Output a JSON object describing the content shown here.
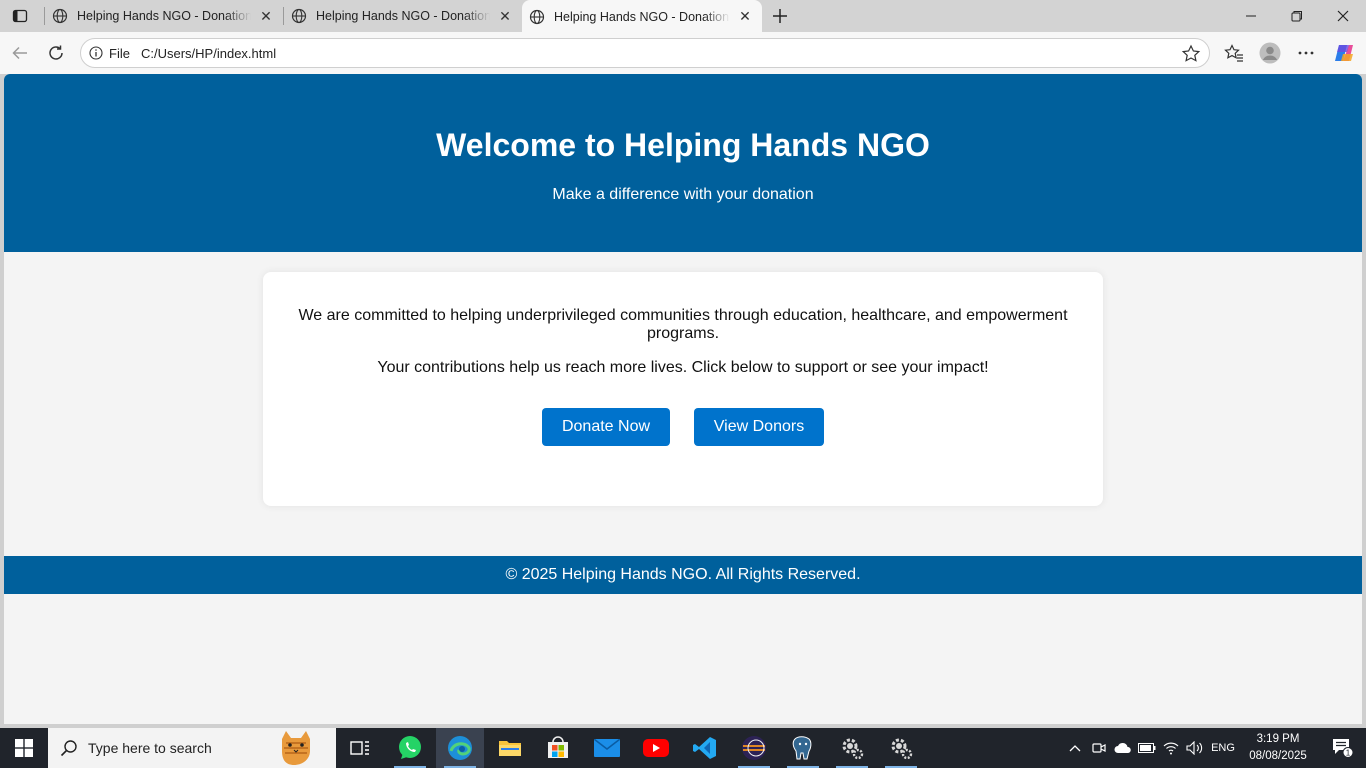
{
  "browser": {
    "tabs": [
      {
        "title": "Helping Hands NGO - Donation P",
        "active": false
      },
      {
        "title": "Helping Hands NGO - Donation P",
        "active": false
      },
      {
        "title": "Helping Hands NGO - Donation P",
        "active": true
      }
    ],
    "address": {
      "scheme_label": "File",
      "url": "C:/Users/HP/index.html"
    }
  },
  "page": {
    "header": {
      "title": "Welcome to Helping Hands NGO",
      "subtitle": "Make a difference with your donation"
    },
    "card": {
      "para1": "We are committed to helping underprivileged communities through education, healthcare, and empowerment programs.",
      "para2": "Your contributions help us reach more lives. Click below to support or see your impact!",
      "donate_label": "Donate Now",
      "donors_label": "View Donors"
    },
    "footer": {
      "text": "© 2025 Helping Hands NGO. All Rights Reserved."
    },
    "colors": {
      "header": "#00609c",
      "button": "#0073cc",
      "background": "#f4f4f4"
    }
  },
  "taskbar": {
    "search_placeholder": "Type here to search",
    "language": "ENG",
    "time": "3:19 PM",
    "date": "08/08/2025",
    "notification_count": "1",
    "pinned": [
      "task-view",
      "whatsapp",
      "edge",
      "file-explorer",
      "microsoft-store",
      "mail",
      "youtube",
      "vscode",
      "eclipse",
      "postgresql",
      "settings",
      "settings"
    ]
  }
}
